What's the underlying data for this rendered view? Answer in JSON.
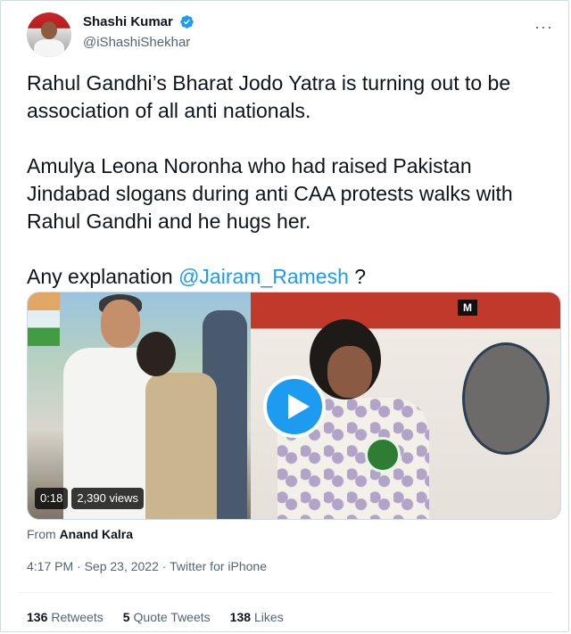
{
  "author": {
    "display_name": "Shashi Kumar",
    "handle": "@iShashiShekhar",
    "verified_icon": "verified-badge-icon",
    "more_label": "···"
  },
  "tweet": {
    "paragraphs": [
      "Rahul Gandhi’s Bharat Jodo Yatra is turning out to be association of all anti nationals.",
      "Amulya Leona Noronha who had raised Pakistan Jindabad slogans during anti CAA protests walks with Rahul Gandhi and he hugs her.",
      "Any explanation "
    ],
    "mention": "@Jairam_Ramesh",
    "suffix": " ?"
  },
  "media": {
    "duration": "0:18",
    "views": "2,390 views",
    "right_logo": "M"
  },
  "attribution": {
    "prefix": "From ",
    "name": "Anand Kalra"
  },
  "meta": {
    "timestamp": "4:17 PM · Sep 23, 2022 · Twitter for iPhone"
  },
  "stats": {
    "retweets_count": "136",
    "retweets_label": "Retweets",
    "quotes_count": "5",
    "quotes_label": "Quote Tweets",
    "likes_count": "138",
    "likes_label": "Likes"
  },
  "colors": {
    "accent": "#1d9bf0",
    "secondary_text": "#536471"
  }
}
